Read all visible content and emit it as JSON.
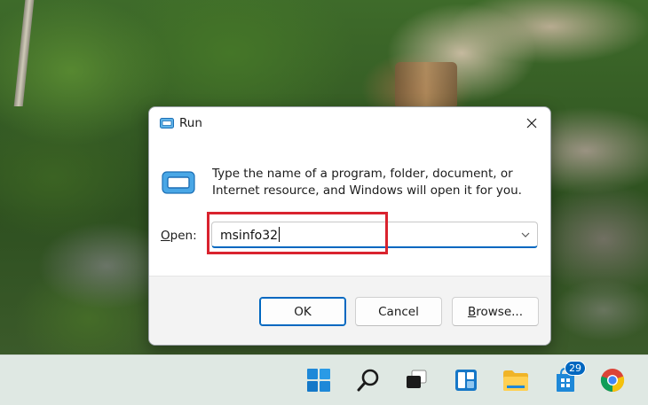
{
  "dialog": {
    "title": "Run",
    "description": "Type the name of a program, folder, document, or Internet resource, and Windows will open it for you.",
    "open_label_prefix": "O",
    "open_label_rest": "pen:",
    "open_value": "msinfo32",
    "ok_label": "OK",
    "cancel_label": "Cancel",
    "browse_label_prefix": "B",
    "browse_label_rest": "rowse..."
  },
  "taskbar": {
    "items": [
      {
        "name": "start-icon"
      },
      {
        "name": "search-icon"
      },
      {
        "name": "task-view-icon"
      },
      {
        "name": "widgets-icon"
      },
      {
        "name": "file-explorer-icon"
      },
      {
        "name": "store-icon"
      },
      {
        "name": "chrome-icon"
      }
    ],
    "store_badge": "29"
  },
  "colors": {
    "accent": "#0067c0",
    "highlight_box": "#d9232e",
    "taskbar": "#dfe8e3"
  }
}
